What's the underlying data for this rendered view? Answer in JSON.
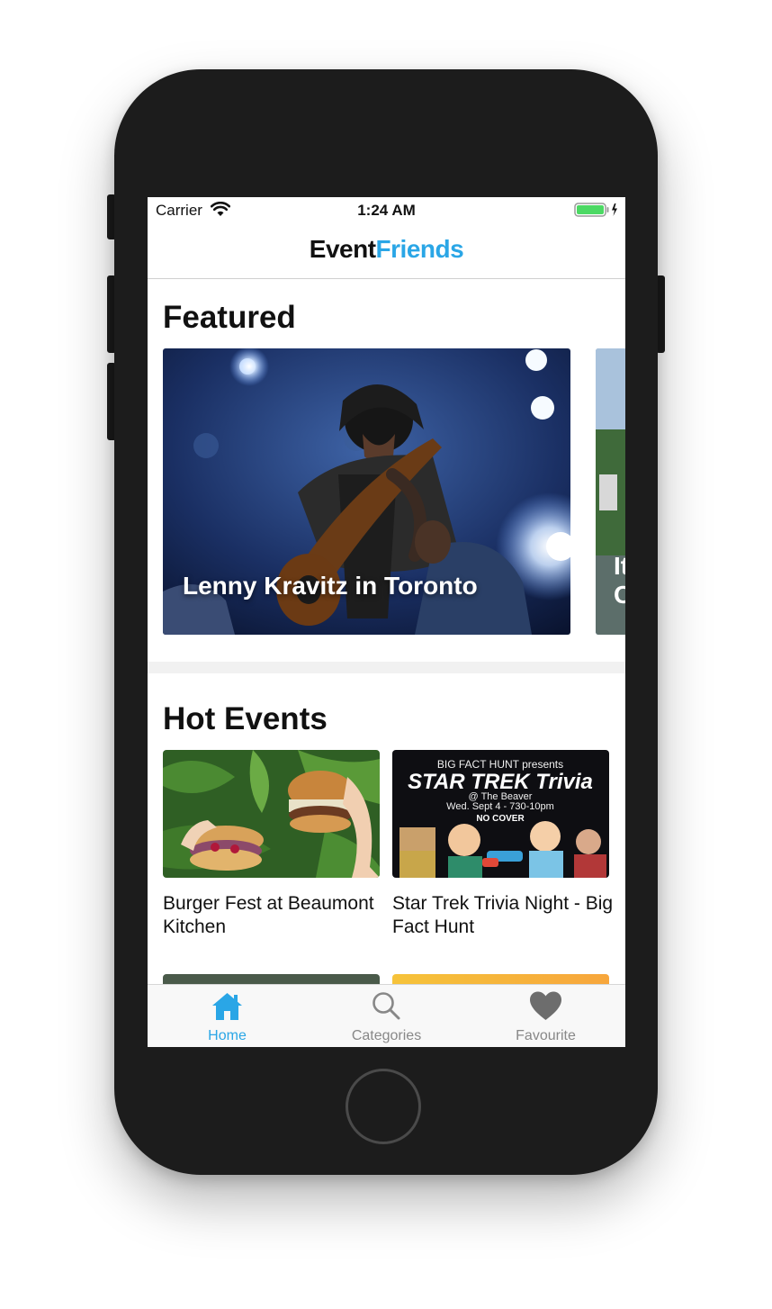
{
  "status_bar": {
    "carrier": "Carrier",
    "time": "1:24 AM",
    "wifi_icon": "wifi-icon",
    "battery_icon": "battery-charging-icon"
  },
  "header": {
    "brand_part1": "Event",
    "brand_part2": "Friends",
    "brand_color_dark": "#111111",
    "brand_color_accent": "#2aa6e6"
  },
  "featured": {
    "title": "Featured",
    "cards": [
      {
        "caption": "Lenny Kravitz in Toronto"
      },
      {
        "caption": "It C"
      }
    ]
  },
  "hot_events": {
    "title": "Hot Events",
    "cards": [
      {
        "name": "Burger Fest at Beaumont Kitchen"
      },
      {
        "name": "Star Trek Trivia Night - Big Fact Hunt",
        "poster": {
          "line1": "BIG FACT HUNT presents",
          "line2": "STAR TREK Trivia",
          "line3": "@ The Beaver",
          "line4": "Wed. Sept 4 - 730-10pm",
          "line5": "NO COVER"
        }
      }
    ]
  },
  "tab_bar": {
    "tabs": [
      {
        "label": "Home",
        "icon": "home-icon",
        "active": true
      },
      {
        "label": "Categories",
        "icon": "search-icon",
        "active": false
      },
      {
        "label": "Favourite",
        "icon": "heart-icon",
        "active": false
      }
    ],
    "active_color": "#2aa6e6",
    "inactive_color": "#888888"
  }
}
